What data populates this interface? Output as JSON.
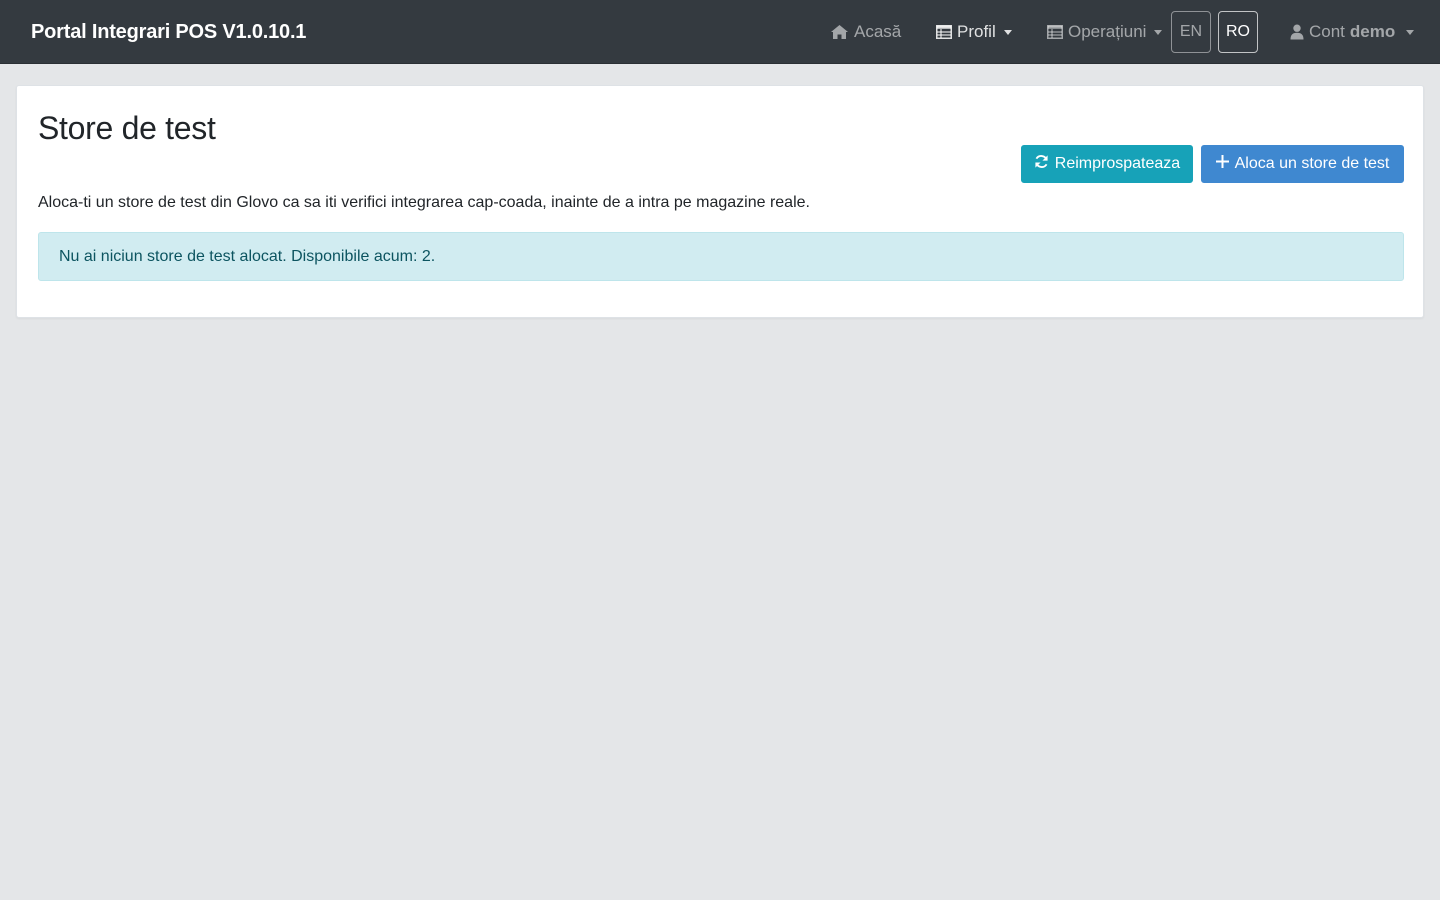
{
  "navbar": {
    "brand": "Portal Integrari POS V1.0.10.1",
    "home_label": "Acasă",
    "profile_label": "Profil",
    "operations_label": "Operațiuni",
    "lang_en": "EN",
    "lang_ro": "RO",
    "account_prefix": "Cont",
    "account_name": "demo"
  },
  "page": {
    "title": "Store de test",
    "refresh_label": "Reimprospateaza",
    "allocate_label": "Aloca un store de test",
    "description": "Aloca-ti un store de test din Glovo ca sa iti verifici integrarea cap-coada, inainte de a intra pe magazine reale.",
    "alert_text": "Nu ai niciun store de test alocat. Disponibile acum: 2."
  },
  "colors": {
    "navbar_bg": "#343a40",
    "page_bg": "#e4e6e8",
    "refresh_button": "#17a2b8",
    "allocate_button": "#3f88d0",
    "alert_bg": "#d1ecf1",
    "alert_text": "#0c5460"
  },
  "icons": {
    "home": "home-icon",
    "profile": "table-icon",
    "operations": "table-icon",
    "account": "user-icon",
    "refresh": "refresh-icon",
    "allocate": "plus-icon"
  }
}
